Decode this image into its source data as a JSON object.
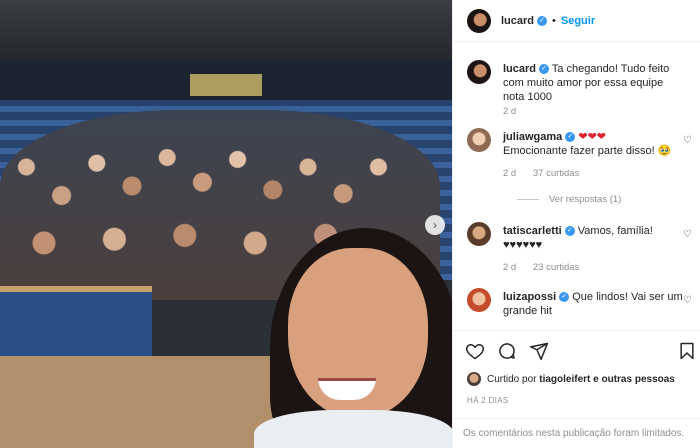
{
  "post": {
    "author": "lucard",
    "follow_label": "Seguir",
    "separator": "•"
  },
  "comments": [
    {
      "user": "lucard",
      "text": "Ta chegando! Tudo feito com muito amor por essa equipe nota 1000",
      "time": "2 d"
    },
    {
      "user": "juliawgama",
      "hearts": "❤❤❤",
      "text": "Emocionante fazer parte disso! 🥹",
      "time": "2 d",
      "likes": "37 curtidas",
      "replies": "Ver respostas (1)"
    },
    {
      "user": "tatiscarletti",
      "text": "Vamos, família! ♥♥♥♥♥♥",
      "time": "2 d",
      "likes": "23 curtidas"
    },
    {
      "user": "luizapossi",
      "text": "Que lindos! Vai ser um grande hit"
    }
  ],
  "likes_summary": {
    "prefix": "Curtido por",
    "user": "tiagoleifert",
    "suffix": "e outras pessoas"
  },
  "post_time": "HÁ 2 DIAS",
  "comments_limited": "Os comentários nesta publicação foram limitados.",
  "icons": [
    "heart-icon",
    "comment-icon",
    "share-icon",
    "bookmark-icon",
    "verified-icon",
    "chevron-right-icon"
  ]
}
